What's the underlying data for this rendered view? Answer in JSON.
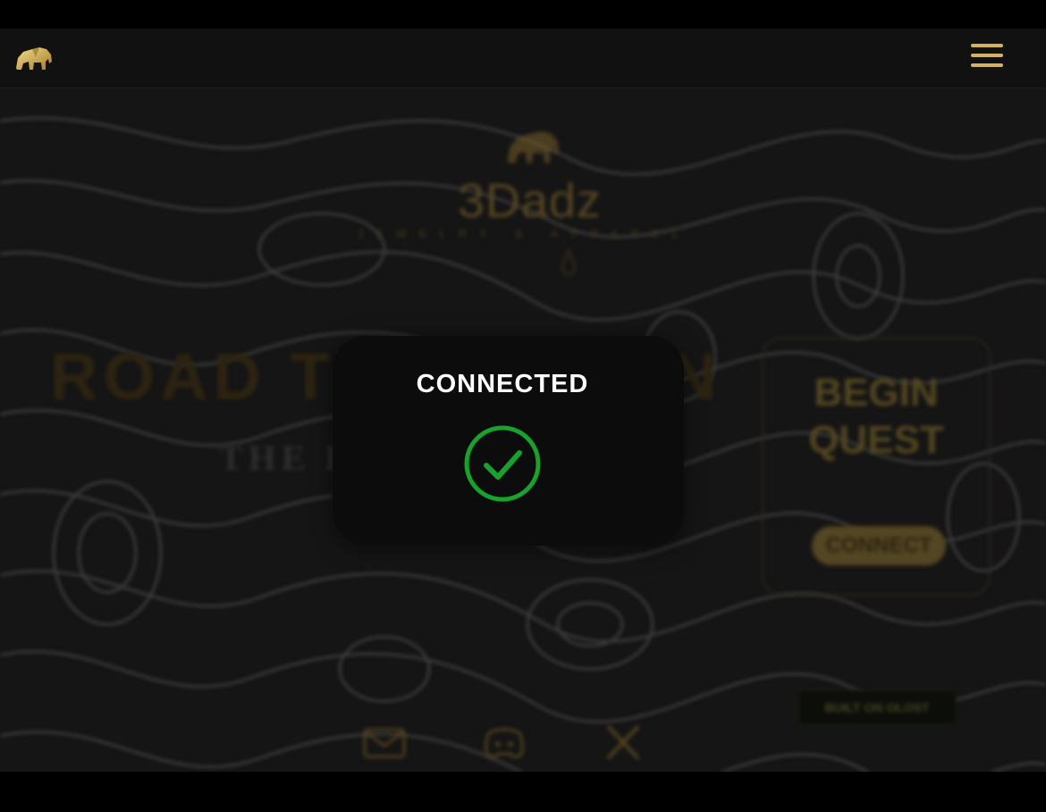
{
  "navbar": {
    "logo": "elephant-logo",
    "menu_icon": "hamburger-menu-icon"
  },
  "hero": {
    "brand_name": "3Dadz",
    "brand_tagline": "JEWELRY & APPAREL",
    "title": "ROAD TO YNGSTN",
    "subtitle": "THE FINAL PIECE"
  },
  "quest_card": {
    "title": "BEGIN QUEST",
    "connect_label": "CONNECT"
  },
  "footer": {
    "built_label": "BUILT ON OLOST",
    "social_icons": [
      "mail-icon",
      "discord-icon",
      "x-icon"
    ]
  },
  "modal": {
    "title": "CONNECTED",
    "icon": "check-circle-icon"
  },
  "colors": {
    "gold": "#d4b35e",
    "success_green": "#17a32b",
    "modal_bg": "#0c0c0c"
  }
}
